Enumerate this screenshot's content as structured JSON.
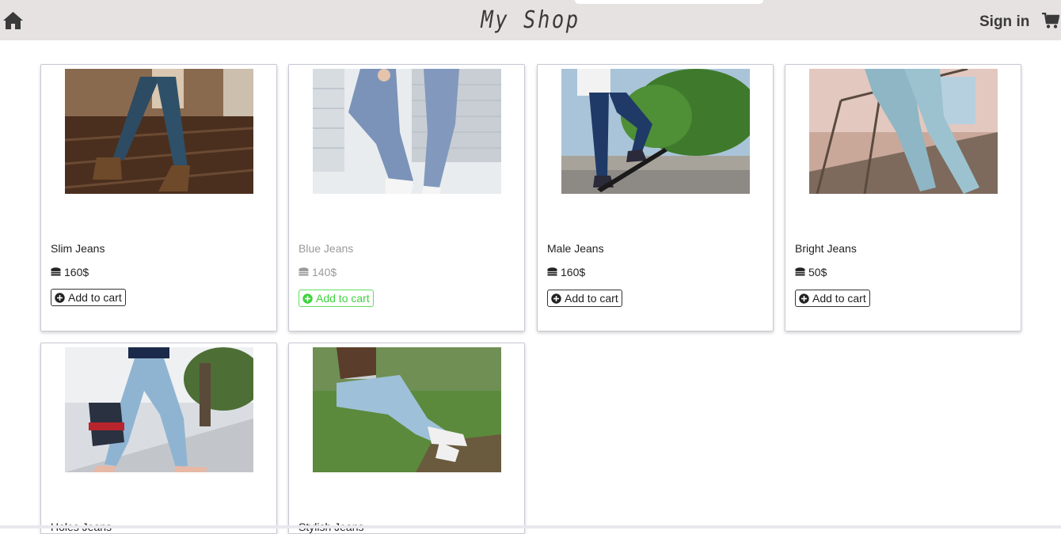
{
  "header": {
    "brand": "My Shop",
    "signin_label": "Sign in",
    "home_icon": "home-icon",
    "cart_icon": "cart-icon"
  },
  "products": [
    {
      "name": "Slim Jeans",
      "price": "160$",
      "add_label": "Add to cart"
    },
    {
      "name": "Blue Jeans",
      "price": "140$",
      "add_label": "Add to cart"
    },
    {
      "name": "Male Jeans",
      "price": "160$",
      "add_label": "Add to cart"
    },
    {
      "name": "Bright Jeans",
      "price": "50$",
      "add_label": "Add to cart"
    },
    {
      "name": "Holes Jeans"
    },
    {
      "name": "Stylish Jeans"
    }
  ],
  "colors": {
    "topbar": "#e6e2e2",
    "hover_accent": "#3ed33e",
    "card_border": "#c9c9d6"
  }
}
